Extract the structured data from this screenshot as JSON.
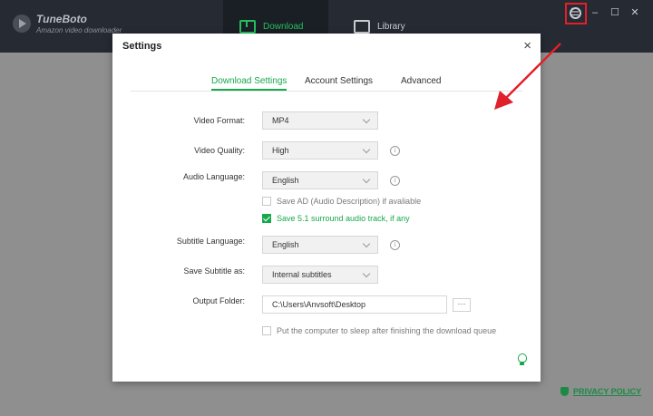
{
  "app": {
    "name": "TuneBoto",
    "subtitle": "Amazon video downloader",
    "nav": [
      {
        "label": "Download"
      },
      {
        "label": "Library"
      }
    ],
    "window_controls": [
      "settings",
      "menu",
      "minimize",
      "maximize",
      "close"
    ]
  },
  "settings_dialog": {
    "title": "Settings",
    "close_icon": "×",
    "tabs": [
      {
        "label": "Download Settings",
        "active": true
      },
      {
        "label": "Account Settings",
        "active": false
      },
      {
        "label": "Advanced",
        "active": false
      }
    ],
    "video_format": {
      "label": "Video Format:",
      "value": "MP4"
    },
    "video_quality": {
      "label": "Video Quality:",
      "value": "High"
    },
    "audio_language": {
      "label": "Audio Language:",
      "value": "English"
    },
    "save_ad": {
      "label": "Save AD (Audio Description) if avaliable",
      "checked": false
    },
    "save_surround": {
      "label": "Save 5.1 surround audio track, if any",
      "checked": true
    },
    "subtitle_language": {
      "label": "Subtitle Language:",
      "value": "English"
    },
    "save_subtitle_as": {
      "label": "Save Subtitle as:",
      "value": "Internal subtitles"
    },
    "output_folder": {
      "label": "Output Folder:",
      "value": "C:\\Users\\Anvsoft\\Desktop",
      "browse_label": "···"
    },
    "sleep_after": {
      "label": "Put the computer to sleep after finishing the download queue",
      "checked": false
    },
    "info_glyph": "i"
  },
  "footer": {
    "privacy_label": "PRIVACY POLICY"
  },
  "colors": {
    "accent": "#17a84c",
    "highlight": "#e0202a",
    "topbar": "#252a33"
  }
}
